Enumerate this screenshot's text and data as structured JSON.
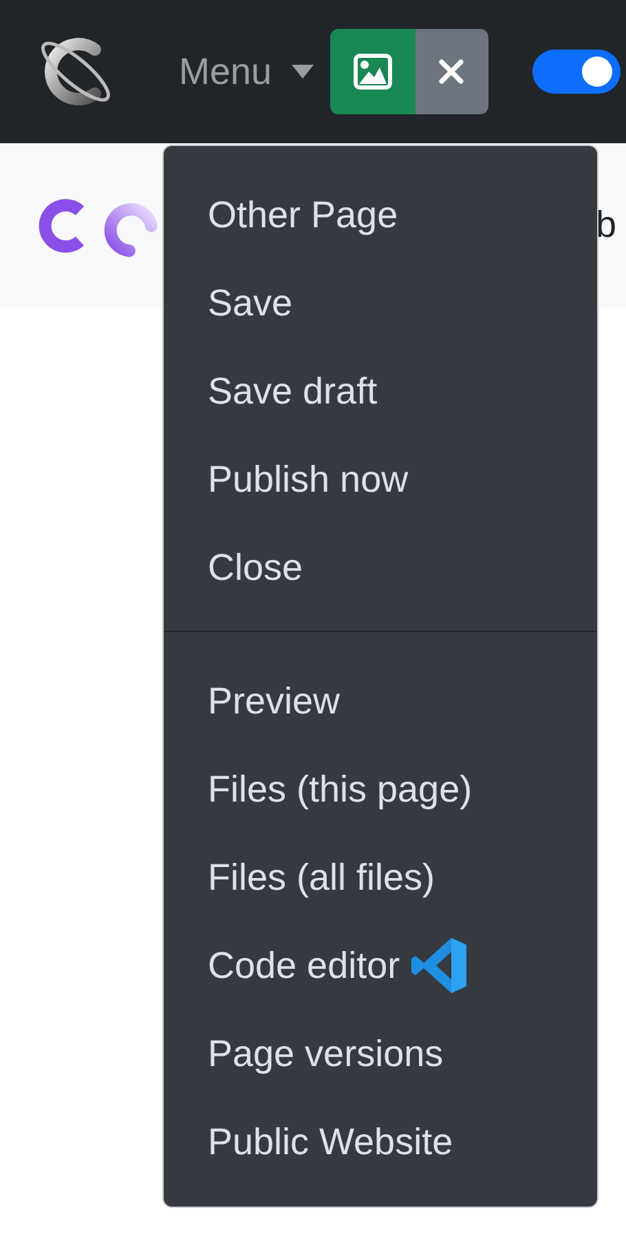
{
  "navbar": {
    "menu_label": "Menu",
    "toggle": {
      "on": true
    }
  },
  "subbar": {
    "cut_text": "b"
  },
  "dropdown": {
    "expanded": true,
    "sections": [
      {
        "items": [
          {
            "label": "Other Page",
            "kind": "plain"
          },
          {
            "label": "Save",
            "kind": "plain"
          },
          {
            "label": "Save draft",
            "kind": "plain"
          },
          {
            "label": "Publish now",
            "kind": "plain"
          },
          {
            "label": "Close",
            "kind": "plain"
          }
        ]
      },
      {
        "items": [
          {
            "label": "Preview",
            "kind": "plain"
          },
          {
            "label": "Files (this page)",
            "kind": "plain"
          },
          {
            "label": "Files (all files)",
            "kind": "plain"
          },
          {
            "label": "Code editor",
            "kind": "editor"
          },
          {
            "label": "Page versions",
            "kind": "plain"
          },
          {
            "label": "Public Website",
            "kind": "plain"
          }
        ]
      }
    ]
  }
}
